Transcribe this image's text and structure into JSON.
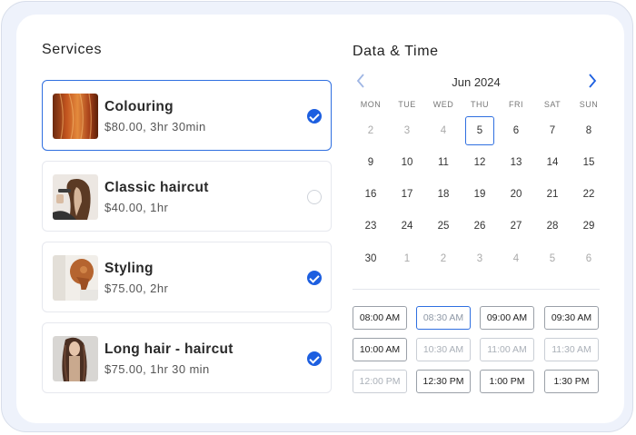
{
  "services": {
    "title": "Services",
    "items": [
      {
        "name": "Colouring",
        "meta": "$80.00, 3hr 30min",
        "checked": true
      },
      {
        "name": "Classic haircut",
        "meta": "$40.00, 1hr",
        "checked": false
      },
      {
        "name": "Styling",
        "meta": "$75.00, 2hr",
        "checked": true
      },
      {
        "name": "Long hair - haircut",
        "meta": "$75.00, 1hr 30 min",
        "checked": true
      }
    ]
  },
  "datetime": {
    "title": "Data & Time",
    "month": "Jun 2024",
    "weekdays": [
      "MON",
      "TUE",
      "WED",
      "THU",
      "FRI",
      "SAT",
      "SUN"
    ],
    "weeks": [
      [
        "2",
        "3",
        "4",
        "5",
        "6",
        "7",
        "8"
      ],
      [
        "9",
        "10",
        "11",
        "12",
        "13",
        "14",
        "15"
      ],
      [
        "16",
        "17",
        "18",
        "19",
        "20",
        "21",
        "22"
      ],
      [
        "23",
        "24",
        "25",
        "26",
        "27",
        "28",
        "29"
      ],
      [
        "30",
        "1",
        "2",
        "3",
        "4",
        "5",
        "6"
      ]
    ],
    "selected_day": "5",
    "slots": [
      [
        "08:00 AM",
        "08:30 AM",
        "09:00 AM",
        "09:30 AM"
      ],
      [
        "10:00 AM",
        "10:30 AM",
        "11:00 AM",
        "11:30 AM"
      ],
      [
        "12:00 PM",
        "12:30 PM",
        "1:00 PM",
        "1:30 PM"
      ]
    ],
    "selected_slot": "08:30 AM",
    "disabled_slots": [
      "10:30 AM",
      "11:00 AM",
      "11:30 AM",
      "12:00 PM"
    ]
  },
  "colors": {
    "accent": "#1d5fe0",
    "border": "#e6e8ee",
    "muted": "#aaaaaa"
  }
}
